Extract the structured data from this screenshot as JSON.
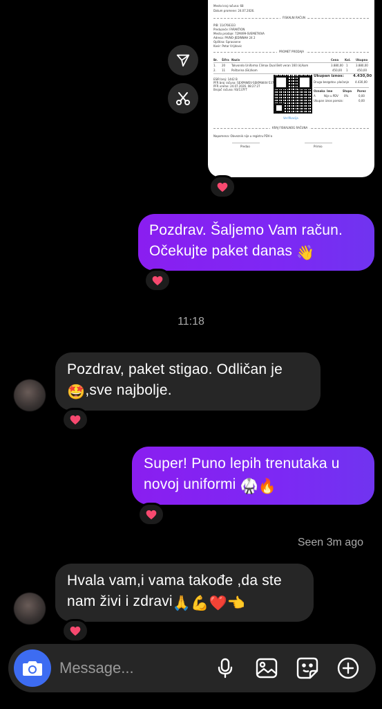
{
  "receipt": {
    "lines_top": [
      "Mesto kraj računa: 68",
      "Datum promene: 24.07.2026."
    ],
    "fiscal_header": "FISKALNI RAČUN",
    "seller_lines": [
      "PIB: 114766333",
      "Preduzeće: FARAKTION",
      "Mesto prodaje: 72M499-SVEMETKIVA",
      "Adresa: PIVNO-JEDINNAH 24 2",
      "Opština: Sprasanne",
      "Kasir: Petar Vrijdovic"
    ],
    "sales_header": "PROMET PRODAJA",
    "table_head": [
      "Br.",
      "Šifra",
      "Naziv",
      "Cena",
      "Kol.",
      "Ukupno"
    ],
    "rows": [
      [
        "1.",
        "20",
        "Takvondo Uniforma Climax Dual Belt veran 160 (k)/kom",
        "3.880,00",
        "1",
        "3.880,00"
      ],
      [
        "2.",
        "11",
        "Poštarina (Ek)/kom",
        "450,00",
        "1",
        "450,00"
      ]
    ],
    "total_label": "Ukupan iznos:",
    "total_value": "4.430,00",
    "other_label": "Druga bezgotov. plaćanje",
    "other_value": "4.430,00",
    "esir_lines": [
      "ESIR broj: 1442 B",
      "PFR broj računa: SEXPAWEV-SEKPAW4V-537",
      "PFR vreme: 24.07.2026. 08:27:27",
      "Brojač računa: 93/137FT"
    ],
    "verification": "Verifikacija",
    "tax_head": [
      "Oznaka",
      "Ime",
      "Stopa",
      "Porez"
    ],
    "tax_row": [
      "A",
      "Nije u PDV",
      "0%",
      "0,00"
    ],
    "tax_total": [
      "Ukupan iznos poreza:",
      "0,00"
    ],
    "end_label": "KRAJ FISKALNOG RAČUNA",
    "note": "Napomena: Obveznik nije u registru PDV-a",
    "sign_left": "Predao",
    "sign_right": "Primio"
  },
  "messages": {
    "m1_line1": "Pozdrav. Šaljemo Vam račun.",
    "m1_line2": "Očekujte paket danas",
    "m1_emoji": "👋",
    "time_divider": "11:18",
    "m2_line1": "Pozdrav, paket stigao. Odličan je",
    "m2_emoji": "🤩",
    "m2_line2": ",sve najbolje.",
    "m3_line1": "Super! Puno lepih trenutaka u",
    "m3_line2": "novoj uniformi",
    "m3_emojis": "🥋🔥",
    "seen": "Seen 3m ago",
    "m4_line1": "Hvala vam,i vama takođe ,da ste",
    "m4_line2": "nam živi i zdravi",
    "m4_emojis": "🙏💪❤️👈"
  },
  "composer": {
    "placeholder": "Message..."
  },
  "icons": {
    "send": "send-icon",
    "cut": "scissors-icon",
    "reaction": "heart-icon",
    "camera": "camera-icon",
    "mic": "microphone-icon",
    "gallery": "image-icon",
    "sticker": "sticker-icon",
    "plus": "plus-icon"
  },
  "colors": {
    "sent_bubble": "#7d28f4",
    "received_bubble": "#262626",
    "camera_button": "#3d6cf2",
    "heart": "#f7496f"
  }
}
